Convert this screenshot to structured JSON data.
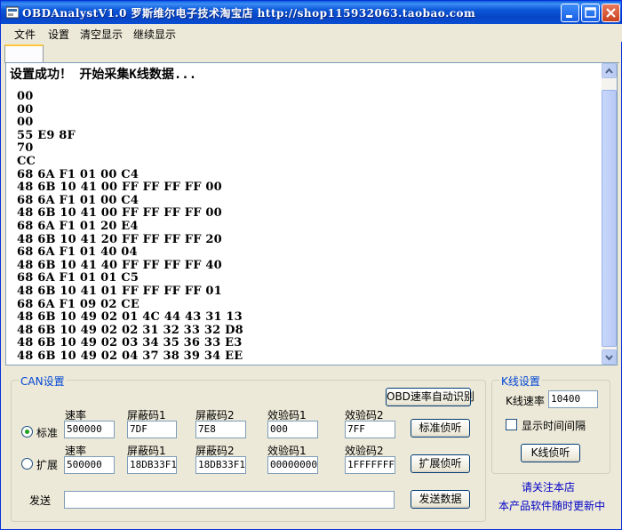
{
  "window": {
    "title": "OBDAnalystV1.0    罗斯维尔电子技术淘宝店   http://shop115932063.taobao.com"
  },
  "menu": [
    "文件",
    "设置",
    "清空显示",
    "继续显示"
  ],
  "display": {
    "header": "设置成功！ 开始采集K线数据...",
    "lines": [
      "00",
      "00",
      "00",
      "55 E9 8F",
      "70",
      "CC",
      "68 6A F1 01 00 C4",
      "48 6B 10 41 00 FF FF FF FF 00",
      "68 6A F1 01 00 C4",
      "48 6B 10 41 00 FF FF FF FF 00",
      "68 6A F1 01 20 E4",
      "48 6B 10 41 20 FF FF FF FF 20",
      "68 6A F1 01 40 04",
      "48 6B 10 41 40 FF FF FF FF 40",
      "68 6A F1 01 01 C5",
      "48 6B 10 41 01 FF FF FF FF 01",
      "68 6A F1 09 02 CE",
      "48 6B 10 49 02 01 4C 44 43 31 13",
      "48 6B 10 49 02 02 31 32 33 32 D8",
      "48 6B 10 49 02 03 34 35 36 33 E3",
      "48 6B 10 49 02 04 37 38 39 34 EE"
    ]
  },
  "can": {
    "title": "CAN设置",
    "auto_detect_button": "OBD速率自动识别",
    "standard": {
      "radio_label": "标准",
      "selected": true,
      "labels": {
        "rate": "速率",
        "mask1": "屏蔽码1",
        "mask2": "屏蔽码2",
        "check1": "效验码1",
        "check2": "效验码2"
      },
      "values": {
        "rate": "500000",
        "mask1": "7DF",
        "mask2": "7E8",
        "check1": "000",
        "check2": "7FF"
      },
      "button": "标准侦听"
    },
    "extended": {
      "radio_label": "扩展",
      "selected": false,
      "labels": {
        "rate": "速率",
        "mask1": "屏蔽码1",
        "mask2": "屏蔽码2",
        "check1": "效验码1",
        "check2": "效验码2"
      },
      "values": {
        "rate": "500000",
        "mask1": "18DB33F1",
        "mask2": "18DB33F1",
        "check1": "00000000",
        "check2": "1FFFFFFF"
      },
      "button": "扩展侦听"
    },
    "send": {
      "label": "发送",
      "value": "",
      "button": "发送数据"
    }
  },
  "kline": {
    "title": "K线设置",
    "rate_label": "K线速率",
    "rate_value": "10400",
    "show_interval_label": "显示时间间隔",
    "show_interval_checked": false,
    "button": "K线侦听"
  },
  "promo": {
    "line1": "请关注本店",
    "line2": "本产品软件随时更新中"
  },
  "colors": {
    "titlebar": "#0a56d8",
    "group_title": "#0046d5",
    "promo_text": "#0000c8",
    "background": "#ece9d8"
  }
}
